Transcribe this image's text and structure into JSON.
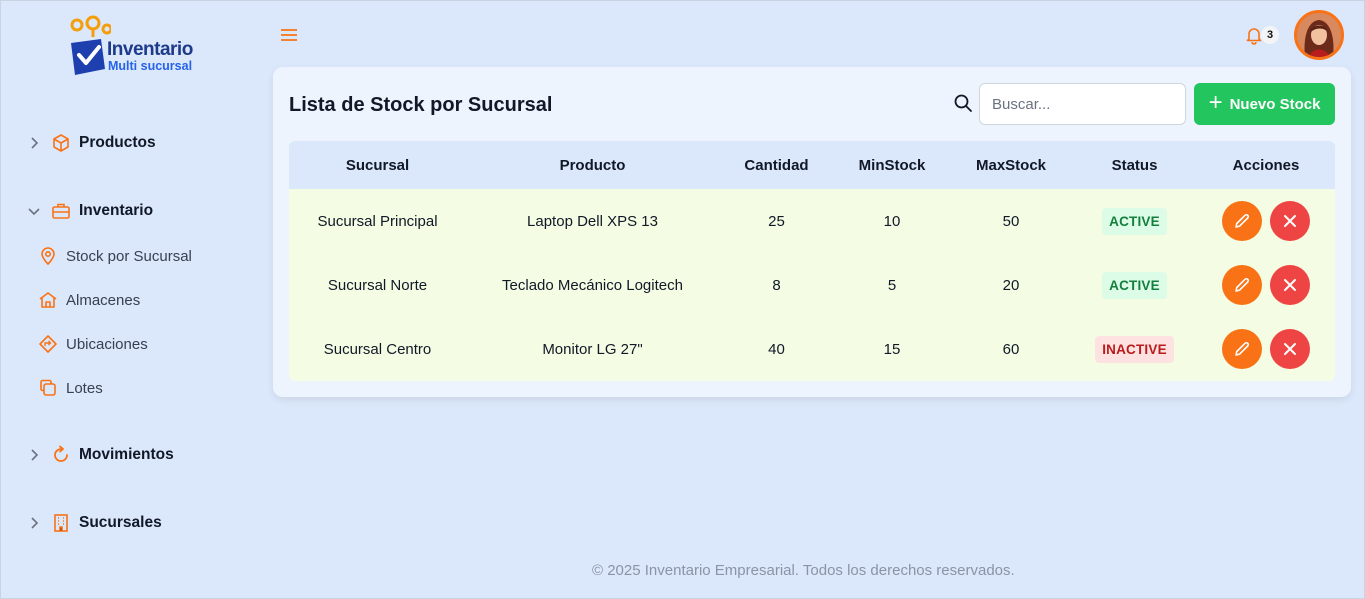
{
  "app": {
    "logo_title": "Inventario",
    "logo_subtitle": "Multi sucursal"
  },
  "sidebar": {
    "sections": [
      {
        "label": "Productos",
        "icon": "box-icon",
        "expanded": false
      },
      {
        "label": "Inventario",
        "icon": "briefcase-icon",
        "expanded": true
      },
      {
        "label": "Movimientos",
        "icon": "refresh-icon",
        "expanded": false
      },
      {
        "label": "Sucursales",
        "icon": "building-icon",
        "expanded": false
      }
    ],
    "inventario_items": [
      {
        "label": "Stock por Sucursal",
        "icon": "map-pin-icon"
      },
      {
        "label": "Almacenes",
        "icon": "home-icon"
      },
      {
        "label": "Ubicaciones",
        "icon": "directions-icon"
      },
      {
        "label": "Lotes",
        "icon": "copy-icon"
      }
    ]
  },
  "topbar": {
    "notification_count": "3"
  },
  "page": {
    "title": "Lista de Stock por Sucursal",
    "search_placeholder": "Buscar...",
    "new_button": "Nuevo Stock"
  },
  "table": {
    "headers": [
      "Sucursal",
      "Producto",
      "Cantidad",
      "MinStock",
      "MaxStock",
      "Status",
      "Acciones"
    ],
    "rows": [
      {
        "sucursal": "Sucursal Principal",
        "producto": "Laptop Dell XPS 13",
        "cantidad": "25",
        "minstock": "10",
        "maxstock": "50",
        "status": "ACTIVE"
      },
      {
        "sucursal": "Sucursal Norte",
        "producto": "Teclado Mecánico Logitech",
        "cantidad": "8",
        "minstock": "5",
        "maxstock": "20",
        "status": "ACTIVE"
      },
      {
        "sucursal": "Sucursal Centro",
        "producto": "Monitor LG 27\"",
        "cantidad": "40",
        "minstock": "15",
        "maxstock": "60",
        "status": "INACTIVE"
      }
    ]
  },
  "footer": {
    "text": "© 2025 Inventario Empresarial. Todos los derechos reservados."
  },
  "colors": {
    "accent": "#f97316",
    "primary_green": "#22c55e",
    "danger": "#ef4444",
    "background": "#dbe8fb"
  }
}
